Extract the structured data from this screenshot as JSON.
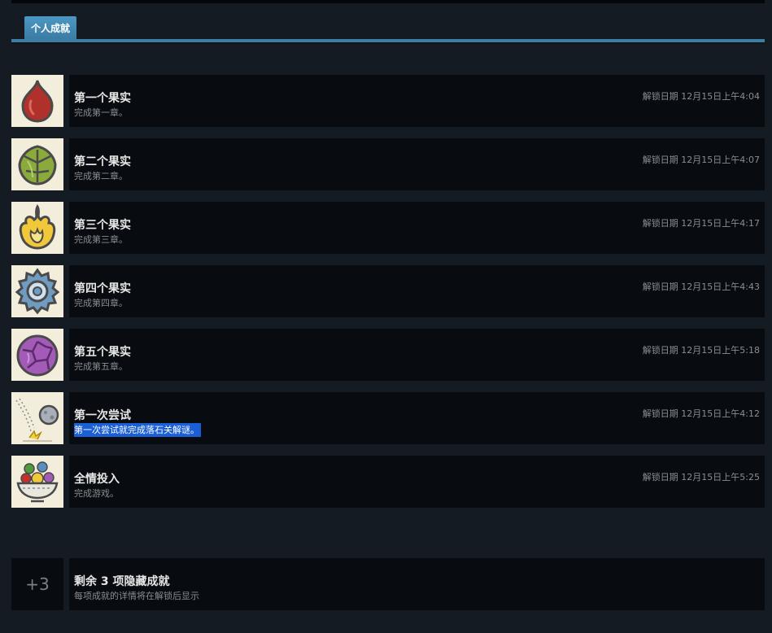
{
  "tab": {
    "label": "个人成就"
  },
  "achievements": [
    {
      "title": "第一个果实",
      "desc": "完成第一章。",
      "unlock": "解锁日期 12月15日上午4:04",
      "icon": "red-fruit-icon"
    },
    {
      "title": "第二个果实",
      "desc": "完成第二章。",
      "unlock": "解锁日期 12月15日上午4:07",
      "icon": "green-leaf-fruit-icon"
    },
    {
      "title": "第三个果实",
      "desc": "完成第三章。",
      "unlock": "解锁日期 12月15日上午4:17",
      "icon": "fire-fruit-icon"
    },
    {
      "title": "第四个果实",
      "desc": "完成第四章。",
      "unlock": "解锁日期 12月15日上午4:43",
      "icon": "gear-fruit-icon"
    },
    {
      "title": "第五个果实",
      "desc": "完成第五章。",
      "unlock": "解锁日期 12月15日上午5:18",
      "icon": "purple-fruit-icon"
    },
    {
      "title": "第一次尝试",
      "desc": "第一次尝试就完成落石关解谜。",
      "unlock": "解锁日期 12月15日上午4:12",
      "icon": "falling-rock-icon"
    },
    {
      "title": "全情投入",
      "desc": "完成游戏。",
      "unlock": "解锁日期 12月15日上午5:25",
      "icon": "fruit-bowl-icon"
    }
  ],
  "hidden": {
    "count": "+3",
    "title": "剩余 3 项隐藏成就",
    "desc": "每项成就的详情将在解锁后显示"
  },
  "colors": {
    "background": "#151b23",
    "row_background": "#080b0f",
    "tab_accent": "#3f7ea3",
    "selection": "#1a5fd6"
  }
}
